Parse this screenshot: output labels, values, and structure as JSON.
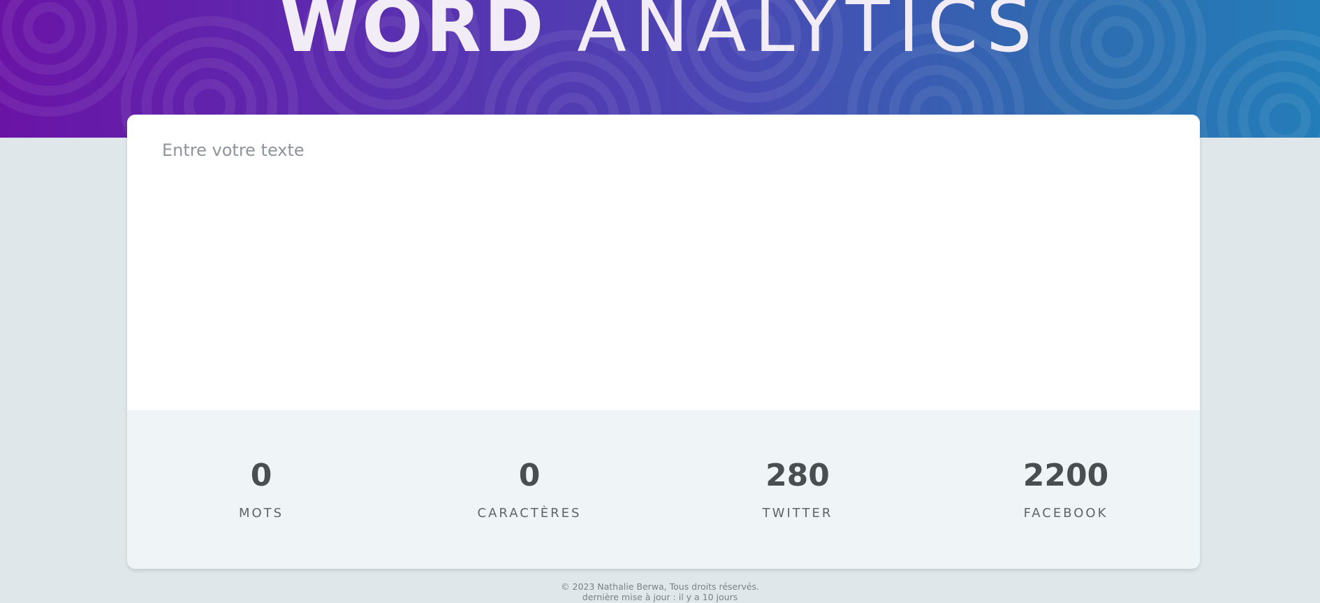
{
  "header": {
    "title_bold": "WORD",
    "title_light": "ANALYTICS"
  },
  "editor": {
    "placeholder": "Entre votre texte",
    "value": ""
  },
  "stats": [
    {
      "value": "0",
      "label": "MOTS"
    },
    {
      "value": "0",
      "label": "CARACTÈRES"
    },
    {
      "value": "280",
      "label": "TWITTER"
    },
    {
      "value": "2200",
      "label": "FACEBOOK"
    }
  ],
  "footer": {
    "copyright": "© 2023 Nathalie Berwa, Tous droits réservés.",
    "updated": "dernière mise à jour : il y a 10 jours"
  },
  "colors": {
    "gradient_start": "#6a14a6",
    "gradient_end": "#237db8",
    "page_background": "#e0e7eb",
    "stats_background": "#eff4f7"
  }
}
